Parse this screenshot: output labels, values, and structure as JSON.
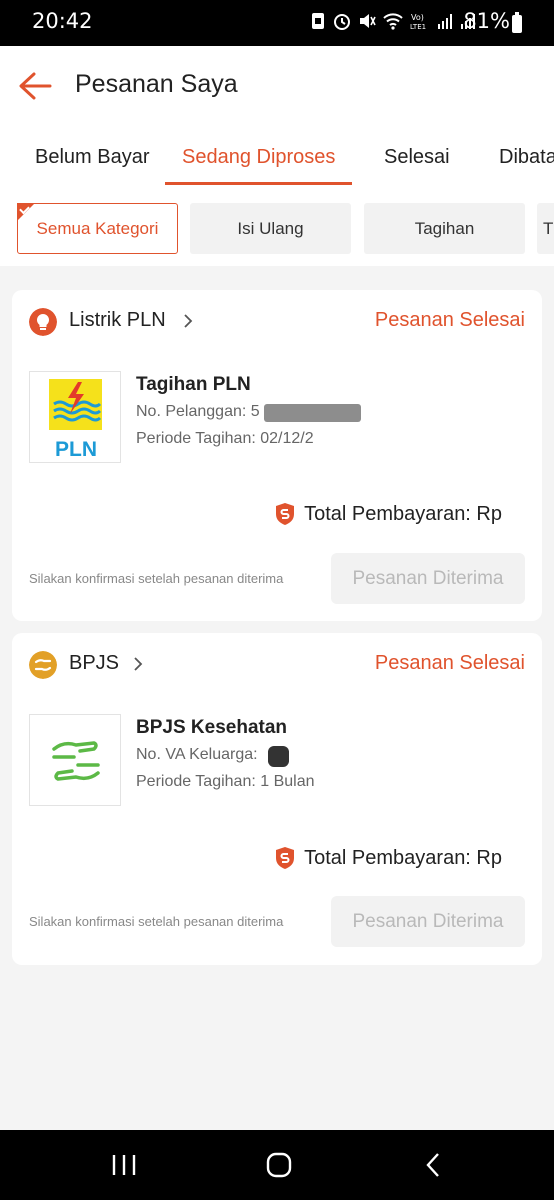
{
  "status_bar": {
    "time": "20:42",
    "battery": "81%"
  },
  "header": {
    "title": "Pesanan Saya"
  },
  "tabs": [
    {
      "label": "Belum Bayar"
    },
    {
      "label": "Sedang Diproses",
      "active": true
    },
    {
      "label": "Selesai"
    },
    {
      "label": "Dibata"
    }
  ],
  "chips": [
    {
      "label": "Semua Kategori",
      "active": true
    },
    {
      "label": "Isi Ulang"
    },
    {
      "label": "Tagihan"
    },
    {
      "label": "T"
    }
  ],
  "orders": [
    {
      "category": "Listrik PLN",
      "status": "Pesanan Selesai",
      "icon": "lightbulb-icon",
      "icon_color": "#e0532d",
      "logo_text": "PLN",
      "product_title": "Tagihan PLN",
      "line1": "No. Pelanggan: 5",
      "line2": "Periode Tagihan: 02/12/2",
      "total": "Total Pembayaran: Rp",
      "hint": "Silakan konfirmasi setelah pesanan diterima",
      "button": "Pesanan Diterima"
    },
    {
      "category": "BPJS",
      "status": "Pesanan Selesai",
      "icon": "bpjs-icon",
      "icon_color": "#e2a027",
      "product_title": "BPJS Kesehatan",
      "line1": "No. VA Keluarga:",
      "line2": "Periode Tagihan: 1 Bulan",
      "total": "Total Pembayaran: Rp",
      "hint": "Silakan konfirmasi setelah pesanan diterima",
      "button": "Pesanan Diterima"
    }
  ],
  "colors": {
    "accent": "#e0532d",
    "bpjs": "#e2a027",
    "pln_yellow": "#f5e11b",
    "pln_blue": "#1c9ad6",
    "bpjs_green": "#5cb946"
  }
}
